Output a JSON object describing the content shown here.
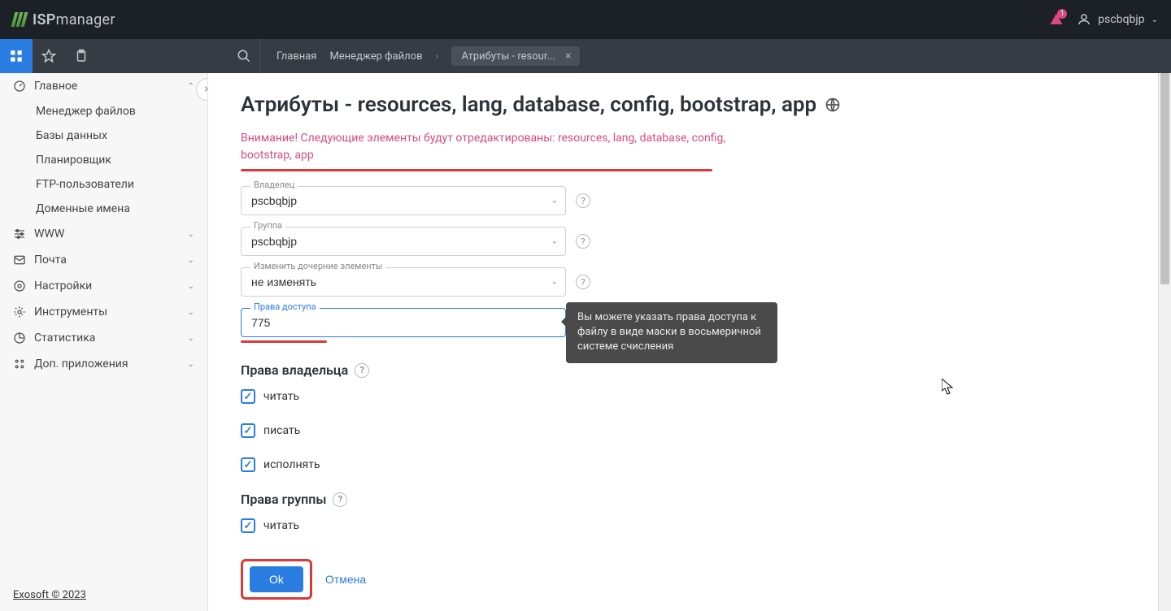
{
  "brand": {
    "name_a": "ISP",
    "name_b": "manager"
  },
  "topbar": {
    "notifications_count": "1",
    "user": "pscbqbjp"
  },
  "toolbar": {
    "breadcrumb_home": "Главная",
    "breadcrumb_fm": "Менеджер файлов",
    "tab_label": "Атрибуты - resour..."
  },
  "sidebar": {
    "main_group": "Главное",
    "main_items": [
      "Менеджер файлов",
      "Базы данных",
      "Планировщик",
      "FTP-пользователи",
      "Доменные имена"
    ],
    "groups": [
      "WWW",
      "Почта",
      "Настройки",
      "Инструменты",
      "Статистика",
      "Доп. приложения"
    ],
    "footer": "Exosoft © 2023"
  },
  "page": {
    "title": "Атрибуты - resources, lang, database, config, bootstrap, app",
    "warning": "Внимание! Следующие элементы будут отредактированы: resources, lang, database, config, bootstrap, app"
  },
  "form": {
    "owner_label": "Владелец",
    "owner_value": "pscbqbjp",
    "group_label": "Группа",
    "group_value": "pscbqbjp",
    "children_label": "Изменить дочерние элементы",
    "children_value": "не изменять",
    "perms_label": "Права доступа",
    "perms_value": "775"
  },
  "sections": {
    "owner_perms_title": "Права владельца",
    "group_perms_title": "Права группы",
    "read": "читать",
    "write": "писать",
    "execute": "исполнять"
  },
  "tooltip": "Вы можете указать права доступа к файлу в виде маски в восьмеричной системе счисления",
  "actions": {
    "ok": "Ok",
    "cancel": "Отмена"
  }
}
